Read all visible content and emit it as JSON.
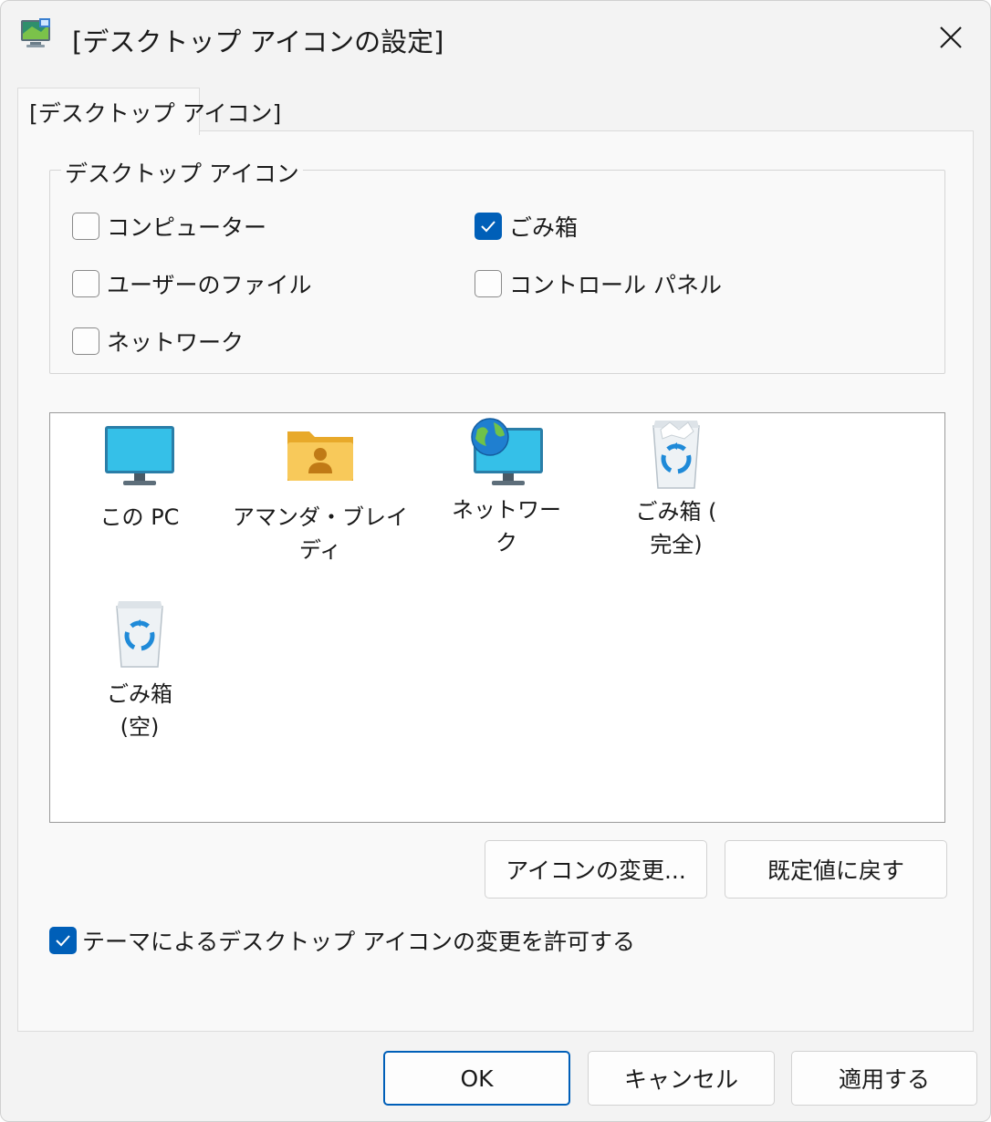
{
  "window": {
    "title": "[デスクトップ アイコンの設定]"
  },
  "tab": {
    "label": "[デスクトップ アイコン]"
  },
  "group": {
    "legend": "デスクトップ アイコン",
    "checkboxes": [
      {
        "label": "コンピューター",
        "checked": false
      },
      {
        "label": "ごみ箱",
        "checked": true
      },
      {
        "label": "ユーザーのファイル",
        "checked": false
      },
      {
        "label": "コントロール パネル",
        "checked": false
      },
      {
        "label": "ネットワーク",
        "checked": false
      }
    ]
  },
  "icons": [
    {
      "label": "この PC",
      "icon": "monitor-icon"
    },
    {
      "label": "アマンダ・ブレイディ",
      "icon": "user-folder-icon"
    },
    {
      "label": "ネットワーク",
      "icon": "network-globe-icon"
    },
    {
      "label_lines": [
        "ごみ箱 (",
        "完全)"
      ],
      "icon": "recycle-bin-full-icon"
    },
    {
      "label_lines": [
        "ごみ箱",
        "(空)"
      ],
      "icon": "recycle-bin-empty-icon"
    }
  ],
  "buttons": {
    "change_icon": "アイコンの変更...",
    "restore_default": "既定値に戻す",
    "ok": "OK",
    "cancel": "キャンセル",
    "apply": "適用する"
  },
  "allow_themes": {
    "label": "テーマによるデスクトップ アイコンの変更を許可する",
    "checked": true
  },
  "colors": {
    "accent": "#005fb8",
    "window_bg": "#f3f3f3",
    "panel_bg": "#f9f9f9"
  }
}
